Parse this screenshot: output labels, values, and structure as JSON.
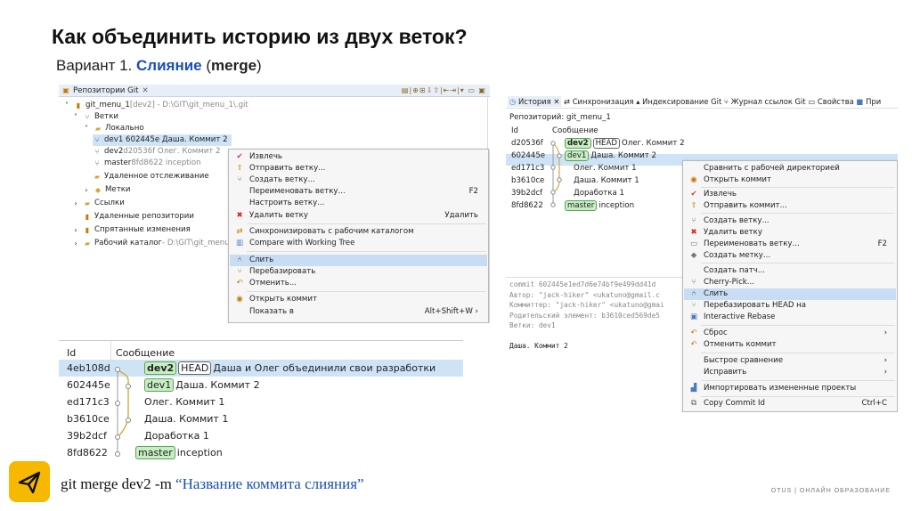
{
  "title": "Как объединить историю из двух веток?",
  "subtitle": {
    "prefix": "Вариант 1. ",
    "keyword": "Слияние",
    "open": " (",
    "merge": "merge",
    "close": ")"
  },
  "left_shot": {
    "panel_title": "Репозитории Git",
    "tree": [
      {
        "text": "git_menu_1",
        "extra": " [dev2] - D:\\GIT\\git_menu_1\\.git",
        "icon": "repo-icon"
      },
      {
        "text": "Ветки",
        "icon": "branches-icon"
      },
      {
        "text": "Локально",
        "icon": "folder-icon"
      },
      {
        "text": "dev1 602445e Даша. Коммит 2",
        "icon": "branch-icon"
      },
      {
        "text": "dev2",
        "extra": " d20536f Олег. Коммит 2",
        "icon": "branch-icon"
      },
      {
        "text": "master",
        "extra": " 8fd8622 inception",
        "icon": "branch-icon"
      },
      {
        "text": "Удаленное отслеживание",
        "icon": "folder-icon"
      },
      {
        "text": "Метки",
        "icon": "tag-icon"
      },
      {
        "text": "Ссылки",
        "icon": "folder-icon"
      },
      {
        "text": "Удаленные репозитории",
        "icon": "remote-icon"
      },
      {
        "text": "Спрятанные изменения",
        "icon": "stash-icon"
      },
      {
        "text": "Рабочий каталог",
        "extra": " - D:\\GIT\\git_menu_",
        "icon": "folder-icon"
      }
    ],
    "menu": [
      {
        "label": "Извлечь",
        "icon": "checkout-icon",
        "shortcut": ""
      },
      {
        "label": "Отправить ветку...",
        "icon": "push-icon",
        "shortcut": ""
      },
      {
        "label": "Создать ветку...",
        "icon": "create-branch-icon",
        "shortcut": ""
      },
      {
        "label": "Переименовать ветку...",
        "icon": "",
        "shortcut": "F2"
      },
      {
        "label": "Настроить ветку...",
        "icon": "",
        "shortcut": ""
      },
      {
        "label": "Удалить ветку",
        "icon": "delete-icon",
        "shortcut": "Удалить"
      },
      {
        "label": "Синхронизировать с рабочим каталогом",
        "icon": "sync-icon",
        "shortcut": ""
      },
      {
        "label": "Compare with Working Tree",
        "icon": "compare-icon",
        "shortcut": ""
      },
      {
        "label": "Слить",
        "icon": "merge-icon",
        "shortcut": ""
      },
      {
        "label": "Перебазировать",
        "icon": "rebase-icon",
        "shortcut": ""
      },
      {
        "label": "Отменить...",
        "icon": "reset-icon",
        "shortcut": ""
      },
      {
        "label": "Открыть коммит",
        "icon": "open-commit-icon",
        "shortcut": ""
      },
      {
        "label": "Показать в",
        "icon": "",
        "shortcut": "Alt+Shift+W ›"
      }
    ]
  },
  "right_shot": {
    "tabs": [
      "История",
      "Синхронизация",
      "Индексирование Git",
      "Журнал ссылок Git",
      "Свойства",
      "При"
    ],
    "repo_label": "Репозиторий: git_menu_1",
    "col_id": "Id",
    "col_msg": "Сообщение",
    "rows": [
      {
        "id": "d20536f",
        "tags": [
          "dev2",
          "HEAD"
        ],
        "msg": "Олег. Коммит 2"
      },
      {
        "id": "602445e",
        "tags": [
          "dev1"
        ],
        "msg": "Даша. Коммит 2"
      },
      {
        "id": "ed171c3",
        "tags": [],
        "msg": "Олег. Коммит 1"
      },
      {
        "id": "b3610ce",
        "tags": [],
        "msg": "Даша. Коммит 1"
      },
      {
        "id": "39b2dcf",
        "tags": [],
        "msg": "Доработка 1"
      },
      {
        "id": "8fd8622",
        "tags": [
          "master"
        ],
        "msg": "inception"
      }
    ],
    "details": [
      "commit 602445e1ed7d6e74bf9e499dd41d",
      "Автор: \"jack-hiker\" <ukatuno@gmail.c",
      "Коммиттер: \"jack-hiker\" <ukatuno@gmai",
      "Родительский элемент: b3610ced569de5",
      "Ветки: dev1",
      "",
      "Даша. Коммит 2"
    ],
    "menu": [
      {
        "label": "Сравнить с рабочей директорией",
        "icon": "",
        "shortcut": ""
      },
      {
        "label": "Открыть коммит",
        "icon": "open-commit-icon",
        "shortcut": ""
      },
      {
        "label": "Извлечь",
        "icon": "checkout-icon",
        "shortcut": ""
      },
      {
        "label": "Отправить коммит...",
        "icon": "push-icon",
        "shortcut": ""
      },
      {
        "label": "Создать ветку...",
        "icon": "create-branch-icon",
        "shortcut": ""
      },
      {
        "label": "Удалить ветку",
        "icon": "delete-icon",
        "shortcut": ""
      },
      {
        "label": "Переименовать ветку...",
        "icon": "rename-icon",
        "shortcut": "F2"
      },
      {
        "label": "Создать метку...",
        "icon": "tag-icon",
        "shortcut": ""
      },
      {
        "label": "Создать патч...",
        "icon": "",
        "shortcut": ""
      },
      {
        "label": "Cherry-Pick...",
        "icon": "cherry-pick-icon",
        "shortcut": ""
      },
      {
        "label": "Слить",
        "icon": "merge-icon",
        "shortcut": ""
      },
      {
        "label": "Перебазировать HEAD на",
        "icon": "rebase-icon",
        "shortcut": ""
      },
      {
        "label": "Interactive Rebase",
        "icon": "interactive-rebase-icon",
        "shortcut": ""
      },
      {
        "label": "Сброс",
        "icon": "reset-icon",
        "shortcut": "›"
      },
      {
        "label": "Отменить коммит",
        "icon": "revert-icon",
        "shortcut": ""
      },
      {
        "label": "Быстрое сравнение",
        "icon": "",
        "shortcut": "›"
      },
      {
        "label": "Исправить",
        "icon": "",
        "shortcut": "›"
      },
      {
        "label": "Импортировать измененные проекты",
        "icon": "import-icon",
        "shortcut": ""
      },
      {
        "label": "Copy Commit Id",
        "icon": "copy-icon",
        "shortcut": "Ctrl+C"
      }
    ]
  },
  "bottom_shot": {
    "col_id": "Id",
    "col_msg": "Сообщение",
    "rows": [
      {
        "id": "4eb108d",
        "tags": [
          "dev2",
          "HEAD"
        ],
        "msg": "Даша и Олег объединили свои разработки"
      },
      {
        "id": "602445e",
        "tags": [
          "dev1"
        ],
        "msg": "Даша. Коммит 2"
      },
      {
        "id": "ed171c3",
        "tags": [],
        "msg": "Олег. Коммит 1"
      },
      {
        "id": "b3610ce",
        "tags": [],
        "msg": "Даша. Коммит 1"
      },
      {
        "id": "39b2dcf",
        "tags": [],
        "msg": "Доработка 1"
      },
      {
        "id": "8fd8622",
        "tags": [
          "master"
        ],
        "msg": "inception"
      }
    ]
  },
  "command": {
    "text": "git merge dev2 -m ",
    "quoted": "“Название коммита слияния”"
  },
  "brand": "OTUS | ОНЛАЙН ОБРАЗОВАНИЕ",
  "colors": {
    "accent": "#1a4fb3",
    "logo_bg": "#f6b900",
    "selection": "#cfe3f7",
    "branch_tag": "#c8eec4"
  }
}
